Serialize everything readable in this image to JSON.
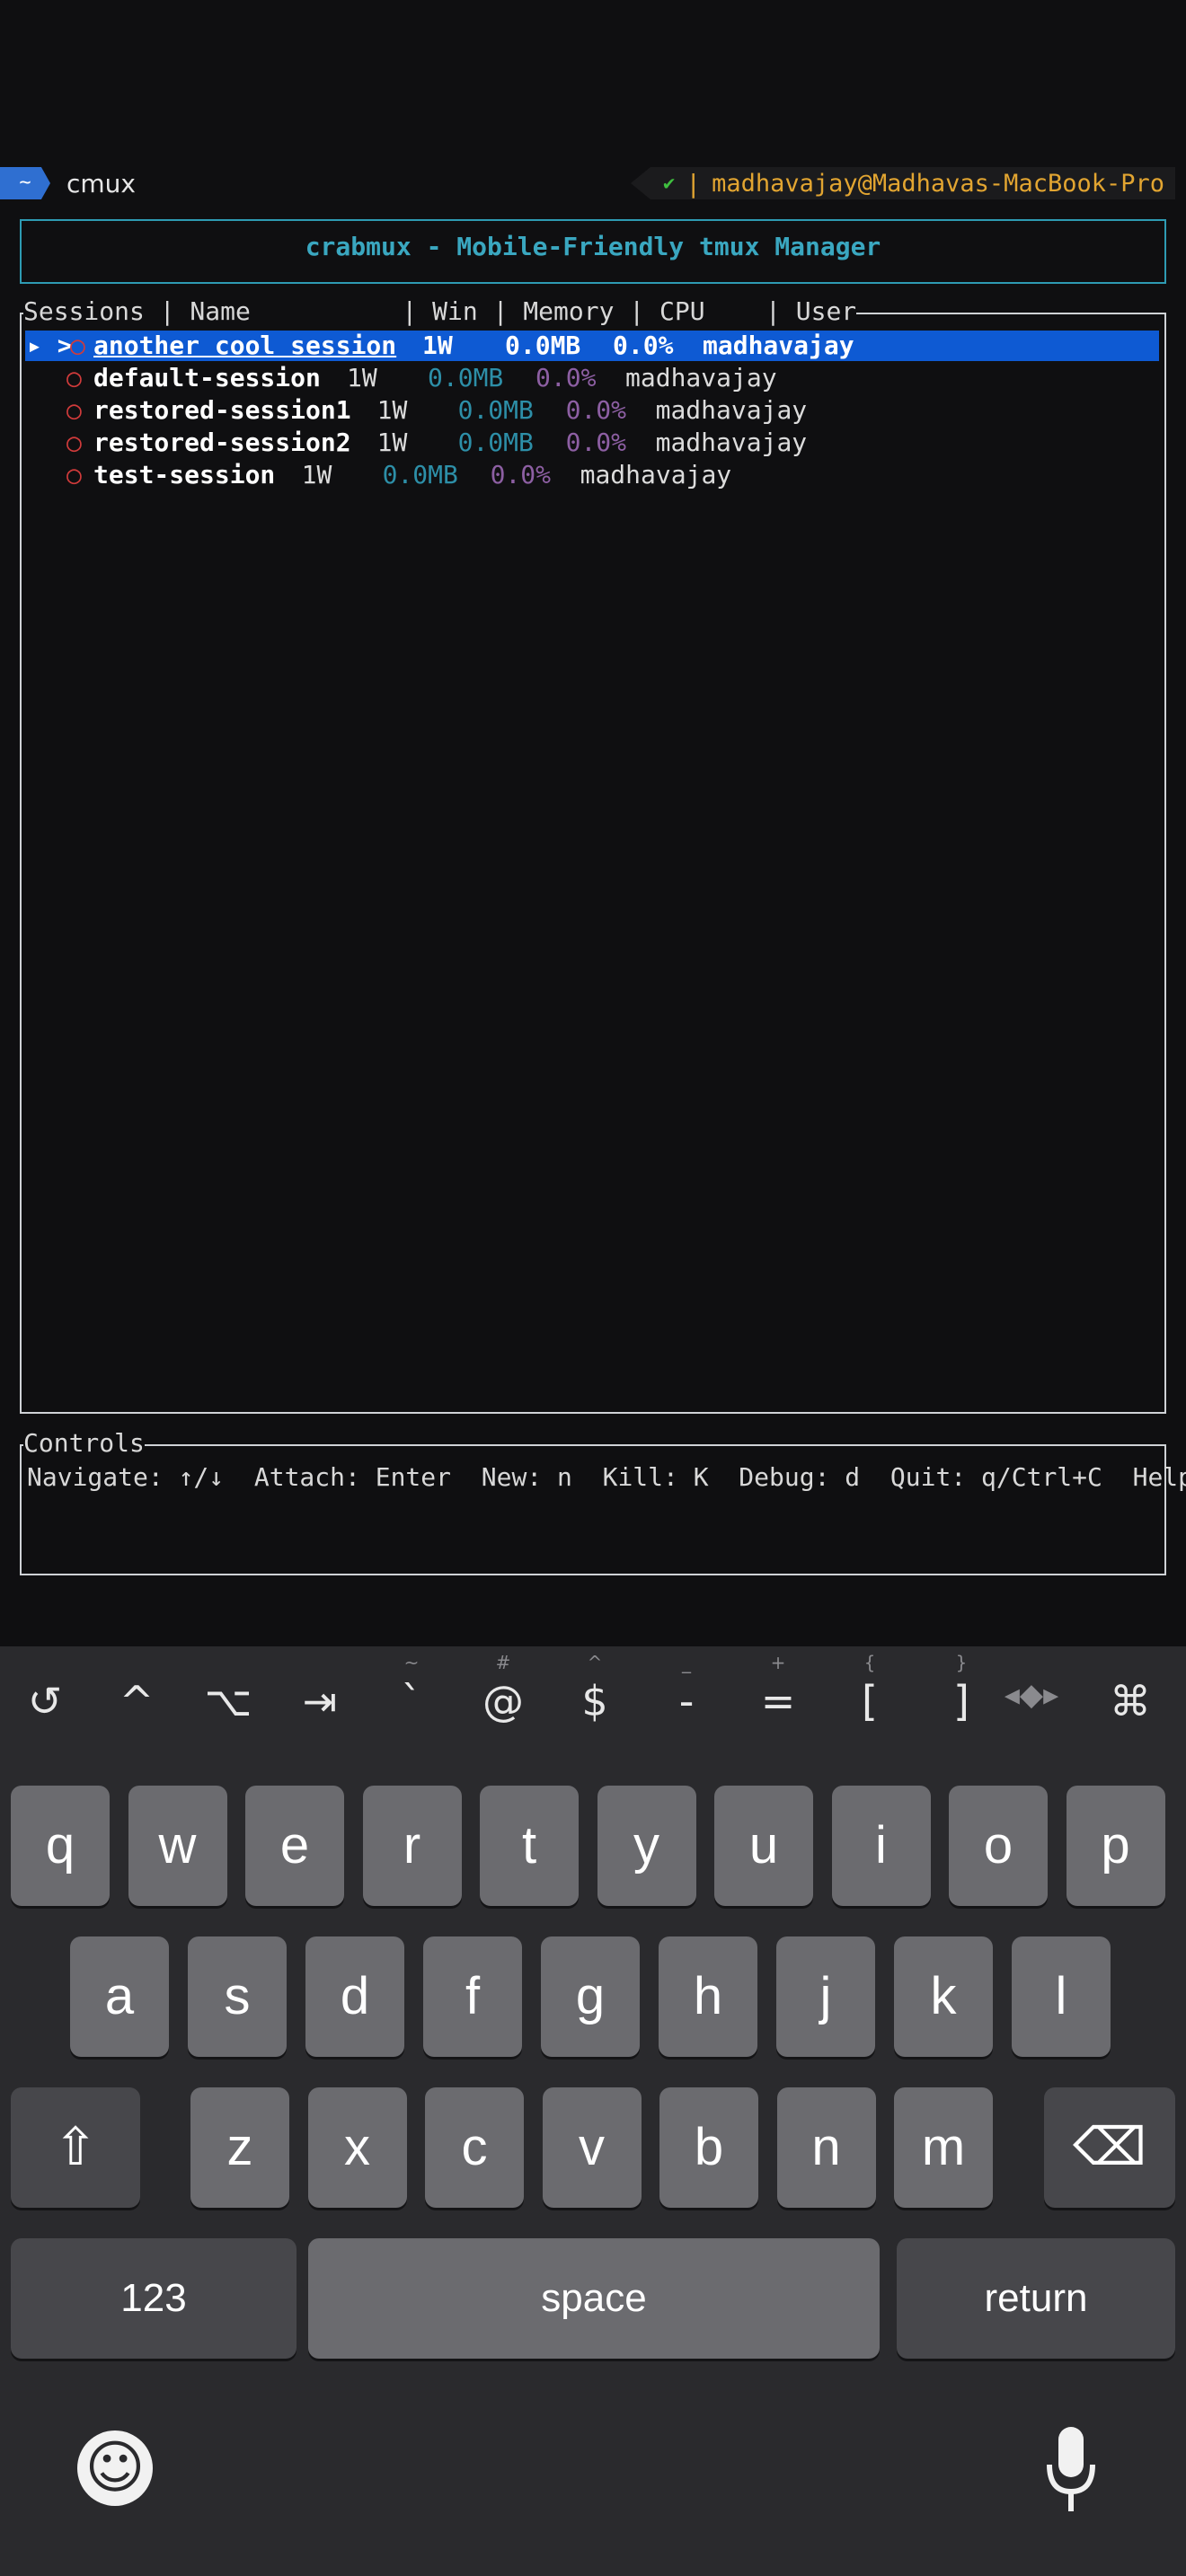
{
  "terminal": {
    "tilde": "~",
    "cwd": "cmux",
    "check": "✔",
    "pipe": "|",
    "user_host": "madhavajay@Madhavas-MacBook-Pro"
  },
  "app": {
    "title": "crabmux - Mobile-Friendly tmux Manager",
    "sessions_header": "Sessions | Name          | Win | Memory | CPU    | User",
    "rows": [
      {
        "marker": "▸ >",
        "bullet": "○",
        "name": "another cool session",
        "win": "1W",
        "mem": "0.0MB",
        "cpu": "0.0%",
        "user": "madhavajay",
        "selected": true
      },
      {
        "marker": "",
        "bullet": "○",
        "name": "default-session",
        "win": "1W",
        "mem": "0.0MB",
        "cpu": "0.0%",
        "user": "madhavajay",
        "selected": false
      },
      {
        "marker": "",
        "bullet": "○",
        "name": "restored-session1",
        "win": "1W",
        "mem": "0.0MB",
        "cpu": "0.0%",
        "user": "madhavajay",
        "selected": false
      },
      {
        "marker": "",
        "bullet": "○",
        "name": "restored-session2",
        "win": "1W",
        "mem": "0.0MB",
        "cpu": "0.0%",
        "user": "madhavajay",
        "selected": false
      },
      {
        "marker": "",
        "bullet": "○",
        "name": "test-session",
        "win": "1W",
        "mem": "0.0MB",
        "cpu": "0.0%",
        "user": "madhavajay",
        "selected": false
      }
    ],
    "controls_title": "Controls",
    "controls_text": "Navigate: ↑/↓  Attach: Enter  New: n  Kill: K  Debug: d  Quit: q/Ctrl+C  Help: ?"
  },
  "accessory_bar": [
    {
      "name": "history-icon",
      "label": "↺",
      "sup": ""
    },
    {
      "name": "ctrl-key",
      "label": "^",
      "sup": ""
    },
    {
      "name": "alt-key",
      "label": "⌥",
      "sup": ""
    },
    {
      "name": "tab-key",
      "label": "⇥",
      "sup": ""
    },
    {
      "name": "backtick-key",
      "label": "`",
      "sup": "~"
    },
    {
      "name": "at-key",
      "label": "@",
      "sup": "#"
    },
    {
      "name": "dollar-key",
      "label": "$",
      "sup": "^"
    },
    {
      "name": "dash-key",
      "label": "-",
      "sup": "_"
    },
    {
      "name": "equals-key",
      "label": "=",
      "sup": "+"
    },
    {
      "name": "bracket-open-key",
      "label": "[",
      "sup": "{"
    },
    {
      "name": "bracket-close-key",
      "label": "]",
      "sup": "}"
    },
    {
      "name": "arrows-icon",
      "label": "◂◆▸",
      "sup": ""
    },
    {
      "name": "command-key",
      "label": "⌘",
      "sup": ""
    }
  ],
  "keyboard": {
    "row1": [
      "q",
      "w",
      "e",
      "r",
      "t",
      "y",
      "u",
      "i",
      "o",
      "p"
    ],
    "row2": [
      "a",
      "s",
      "d",
      "f",
      "g",
      "h",
      "j",
      "k",
      "l"
    ],
    "row3": [
      "z",
      "x",
      "c",
      "v",
      "b",
      "n",
      "m"
    ],
    "shift": "⇧",
    "backspace": "⌫",
    "numbers": "123",
    "space": "space",
    "return": "return",
    "emoji": "☺",
    "mic": "🎤"
  }
}
